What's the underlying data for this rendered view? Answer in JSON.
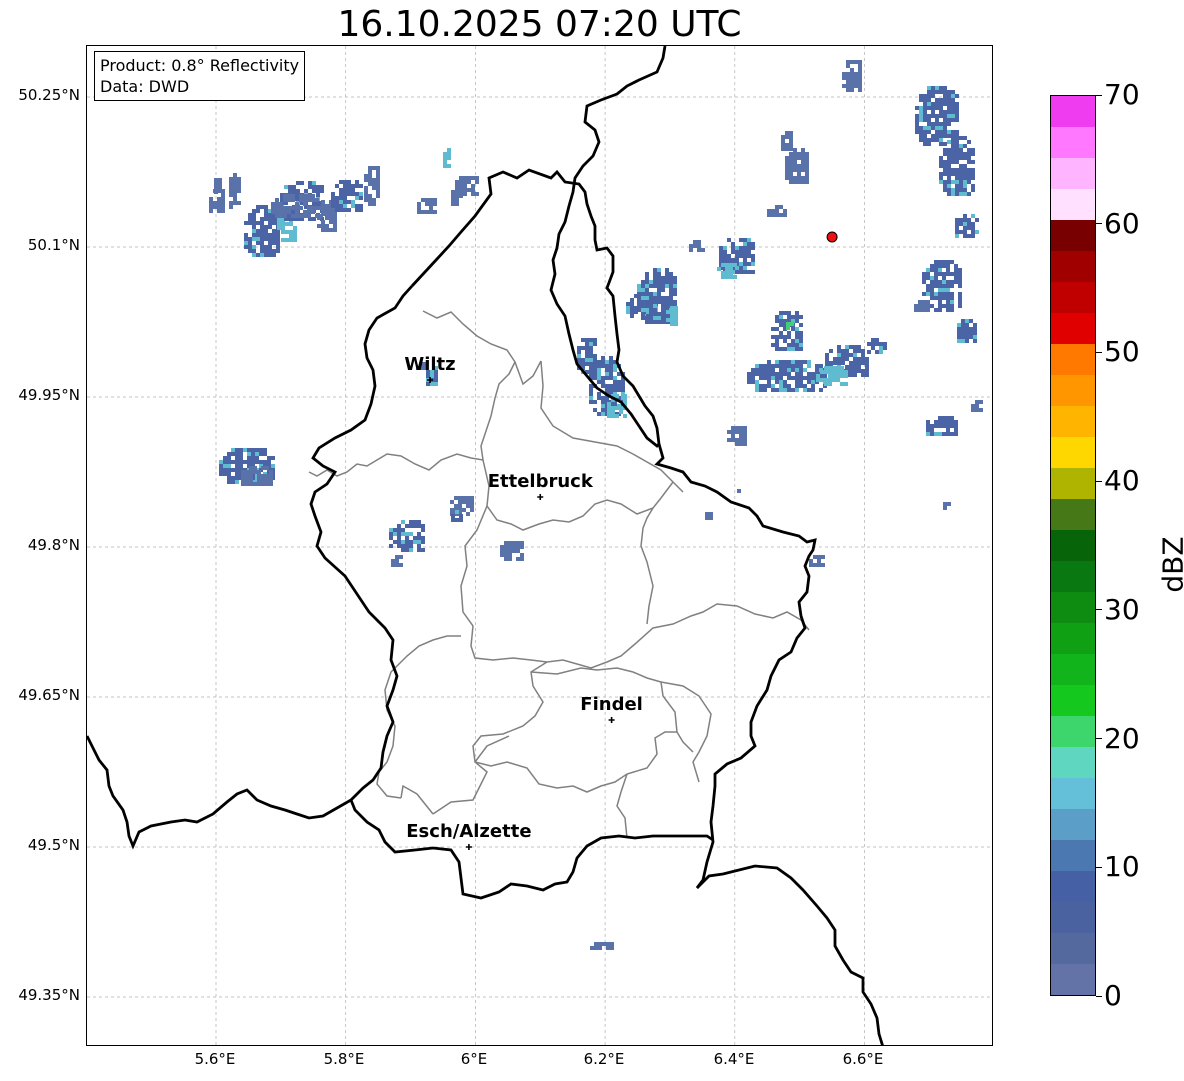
{
  "title": "16.10.2025 07:20 UTC",
  "info": {
    "product": "Product: 0.8° Reflectivity",
    "data": "Data: DWD"
  },
  "lat_ticks": [
    "50.25°N",
    "50.1°N",
    "49.95°N",
    "49.8°N",
    "49.65°N",
    "49.5°N",
    "49.35°N"
  ],
  "lon_ticks": [
    "5.6°E",
    "5.8°E",
    "6°E",
    "6.2°E",
    "6.4°E",
    "6.6°E"
  ],
  "cities": [
    {
      "name": "Wiltz",
      "lon": 5.93,
      "lat": 49.967
    },
    {
      "name": "Ettelbruck",
      "lon": 6.1,
      "lat": 49.85
    },
    {
      "name": "Findel",
      "lon": 6.21,
      "lat": 49.627
    },
    {
      "name": "Esch/Alzette",
      "lon": 5.99,
      "lat": 49.5
    }
  ],
  "radar_site": {
    "lon": 6.55,
    "lat": 50.11,
    "color": "#ee1111"
  },
  "colorbar": {
    "label": "dBZ",
    "min": 0,
    "max": 70,
    "tick_labels": [
      "0",
      "10",
      "20",
      "30",
      "40",
      "50",
      "60",
      "70"
    ],
    "colors": [
      "#6373a8",
      "#546a9e",
      "#4a62a0",
      "#4560a4",
      "#4b78b0",
      "#5b9ec7",
      "#64c0d8",
      "#5fd6c0",
      "#3cd66c",
      "#14c81e",
      "#12b41c",
      "#10a014",
      "#0e8c12",
      "#0a7810",
      "#086408",
      "#467818",
      "#afb400",
      "#ffd700",
      "#ffb400",
      "#ff9600",
      "#ff7800",
      "#e10000",
      "#c00000",
      "#a00000",
      "#780000",
      "#ffe1ff",
      "#ffb4ff",
      "#ff78ff",
      "#f03cf0"
    ]
  },
  "colors": {
    "border": "#000000",
    "canton_border": "#808080",
    "grid": "#b0b0b0",
    "echo_light": "#5a72aa",
    "echo_mid": "#4a64a6",
    "echo_cyan": "#5fbcd0",
    "echo_green": "#40d070"
  }
}
